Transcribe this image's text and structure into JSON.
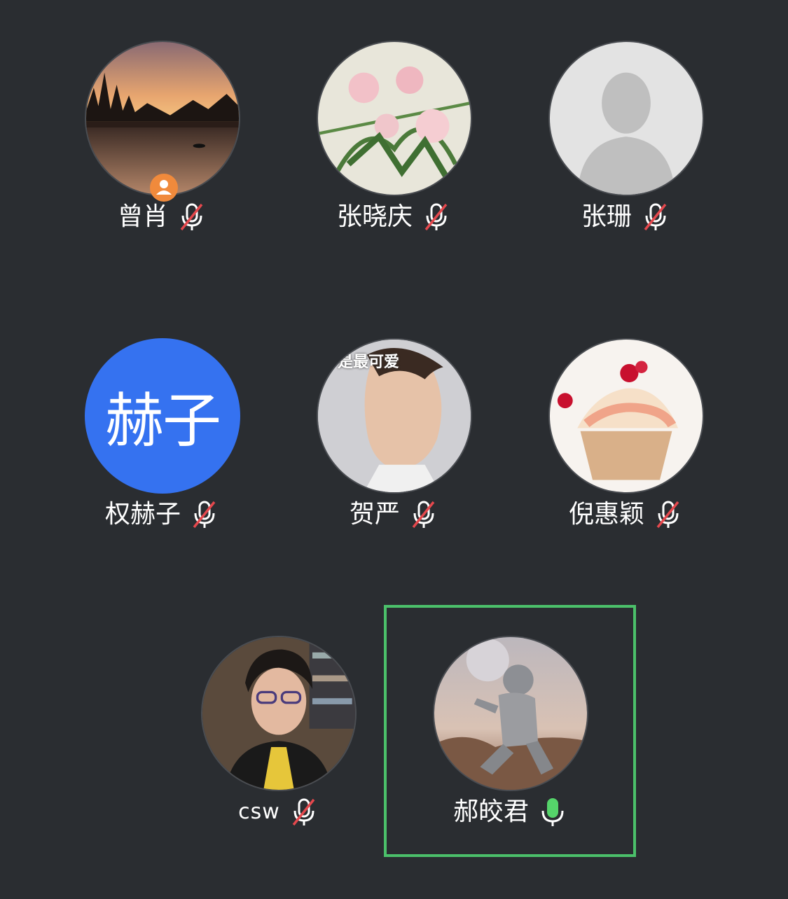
{
  "participants": [
    {
      "name": "曾肖",
      "mic": "muted",
      "host": true,
      "avatar": "sunset-lake-photo"
    },
    {
      "name": "张晓庆",
      "mic": "muted",
      "avatar": "pink-flowers-photo"
    },
    {
      "name": "张珊",
      "mic": "muted",
      "avatar": "default-person-placeholder"
    },
    {
      "name": "权赫子",
      "mic": "muted",
      "avatar_text": "赫子",
      "avatar_color": "#3572f0"
    },
    {
      "name": "贺严",
      "mic": "muted",
      "avatar": "young-man-photo",
      "avatar_caption": "是最可爱"
    },
    {
      "name": "倪惠颖",
      "mic": "muted",
      "avatar": "cupcake-photo"
    },
    {
      "name": "csw",
      "mic": "muted",
      "avatar": "woman-with-glasses-photo"
    },
    {
      "name": "郝皎君",
      "mic": "speaking",
      "active": true,
      "avatar": "astronaut-photo"
    }
  ],
  "colors": {
    "background": "#2a2d31",
    "muted_slash": "#e5484d",
    "speaking_mic": "#55d46a",
    "active_frame": "#4bc06a",
    "host_badge": "#f08a3c"
  }
}
